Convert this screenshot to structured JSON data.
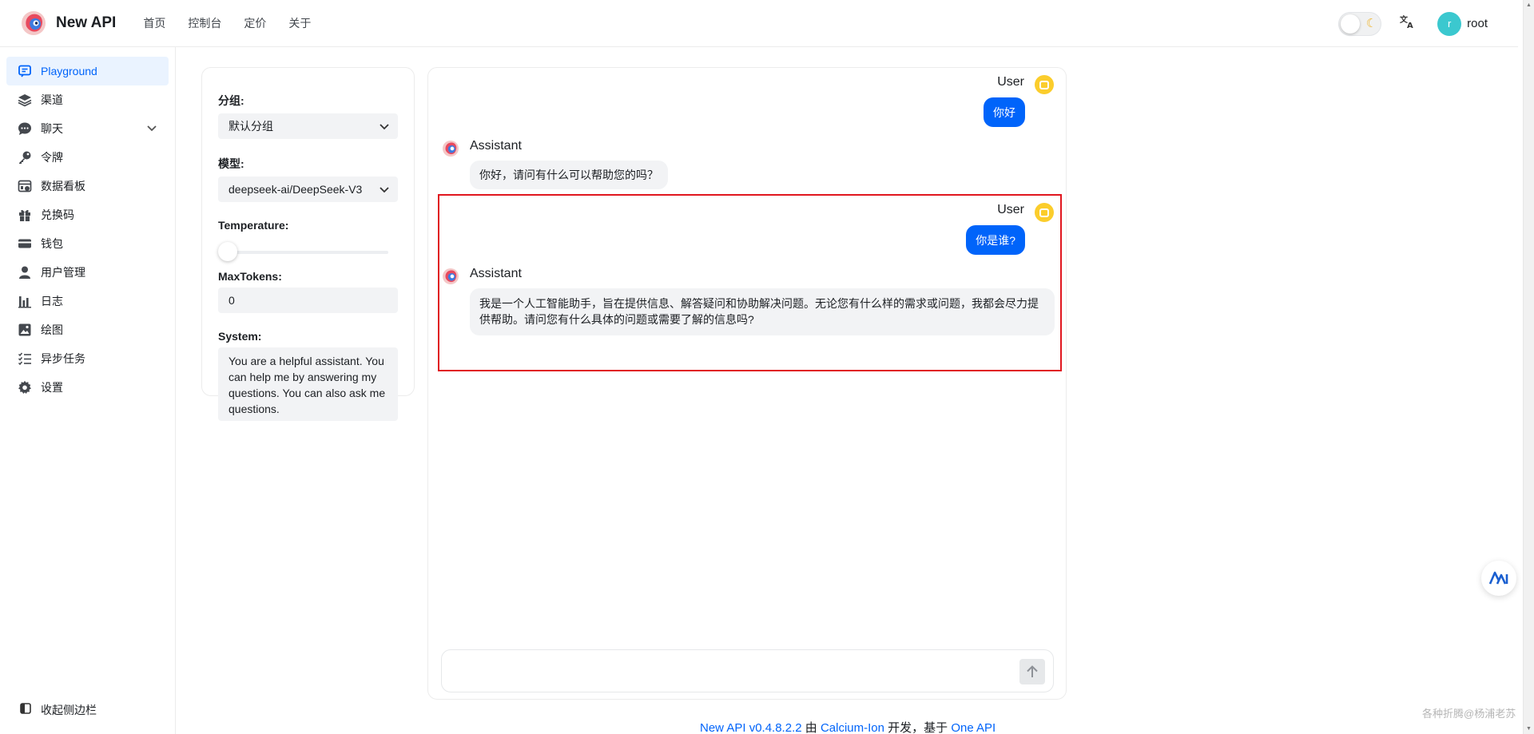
{
  "header": {
    "brand": "New API",
    "nav": [
      "首页",
      "控制台",
      "定价",
      "关于"
    ],
    "user": {
      "initial": "r",
      "name": "root"
    }
  },
  "sidebar": {
    "items": [
      {
        "label": "Playground",
        "icon": "chat-bubble-icon",
        "active": true
      },
      {
        "label": "渠道",
        "icon": "layers-icon"
      },
      {
        "label": "聊天",
        "icon": "comment-icon",
        "expandable": true
      },
      {
        "label": "令牌",
        "icon": "key-icon"
      },
      {
        "label": "数据看板",
        "icon": "dashboard-icon"
      },
      {
        "label": "兑换码",
        "icon": "gift-icon"
      },
      {
        "label": "钱包",
        "icon": "wallet-icon"
      },
      {
        "label": "用户管理",
        "icon": "user-icon"
      },
      {
        "label": "日志",
        "icon": "histogram-icon"
      },
      {
        "label": "绘图",
        "icon": "image-icon"
      },
      {
        "label": "异步任务",
        "icon": "checklist-icon"
      },
      {
        "label": "设置",
        "icon": "gear-icon"
      }
    ],
    "collapse_label": "收起侧边栏"
  },
  "settings": {
    "group_label": "分组:",
    "group_value": "默认分组",
    "model_label": "模型:",
    "model_value": "deepseek-ai/DeepSeek-V3",
    "temperature_label": "Temperature:",
    "temperature_value": 0,
    "maxtokens_label": "MaxTokens:",
    "maxtokens_value": "0",
    "system_label": "System:",
    "system_value": "You are a helpful assistant. You can help me by answering my questions. You can also ask me questions."
  },
  "chat": {
    "messages": [
      {
        "role": "User",
        "text": "你好"
      },
      {
        "role": "Assistant",
        "text": "你好，请问有什么可以帮助您的吗？"
      },
      {
        "role": "User",
        "text": "你是谁?"
      },
      {
        "role": "Assistant",
        "text": "我是一个人工智能助手，旨在提供信息、解答疑问和协助解决问题。无论您有什么样的需求或问题，我都会尽力提供帮助。请问您有什么具体的问题或需要了解的信息吗?"
      }
    ],
    "input_value": ""
  },
  "footer": {
    "version_link": "New API v0.4.8.2.2",
    "by": "由",
    "author_link": "Calcium-Ion",
    "dev": "开发，基于",
    "base_link": "One API"
  },
  "watermark": "各种折腾@杨浦老苏",
  "colors": {
    "accent": "#0064fa",
    "highlight_border": "#e0161f",
    "user_avatar": "#fbcd2c",
    "avatar": "#3bc8cf"
  }
}
